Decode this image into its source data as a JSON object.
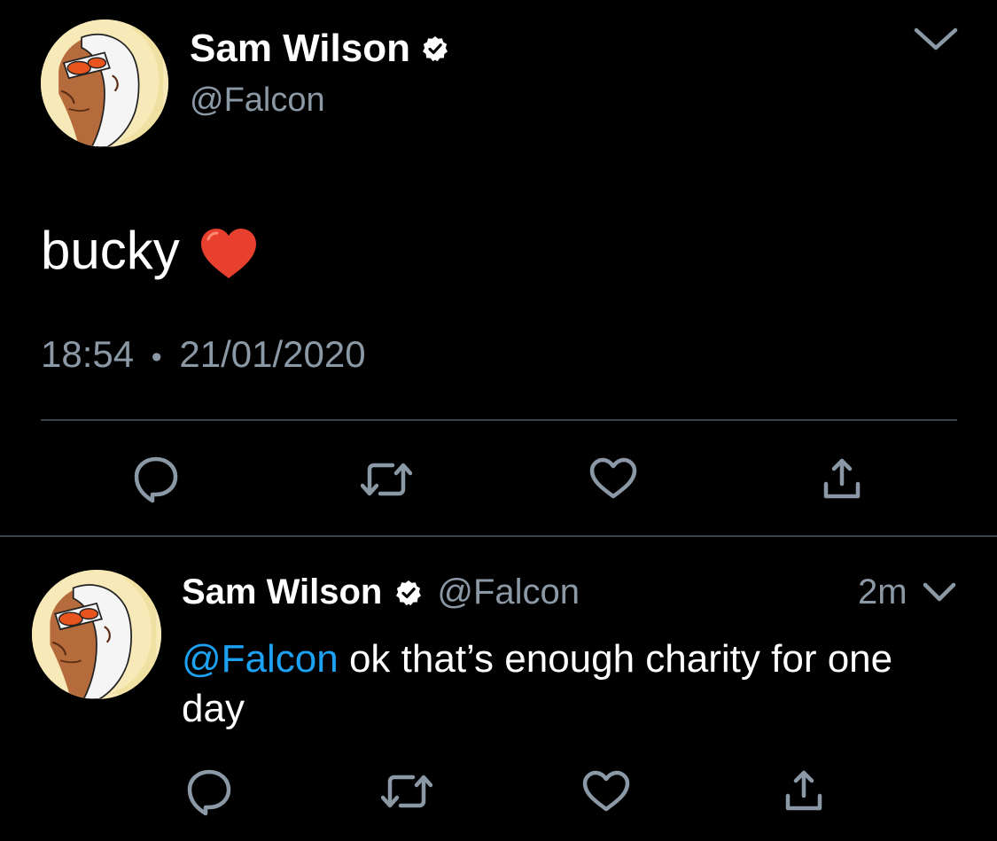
{
  "main_tweet": {
    "display_name": "Sam Wilson",
    "handle": "@Falcon",
    "text": "bucky",
    "emoji": "heart-emoji",
    "time": "18:54",
    "separator": "•",
    "date": "21/01/2020",
    "actions": [
      "reply-icon",
      "retweet-icon",
      "like-icon",
      "share-icon"
    ]
  },
  "reply_tweet": {
    "display_name": "Sam Wilson",
    "handle": "@Falcon",
    "age": "2m",
    "mention": "@Falcon",
    "text": " ok that’s enough charity for one day",
    "actions": [
      "reply-icon",
      "retweet-icon",
      "like-icon",
      "share-icon"
    ]
  },
  "colors": {
    "background": "#000000",
    "primary_text": "#ffffff",
    "secondary_text": "#8b98a5",
    "mention": "#1da1f2",
    "divider": "#38444d",
    "heart": "#e8402f"
  }
}
